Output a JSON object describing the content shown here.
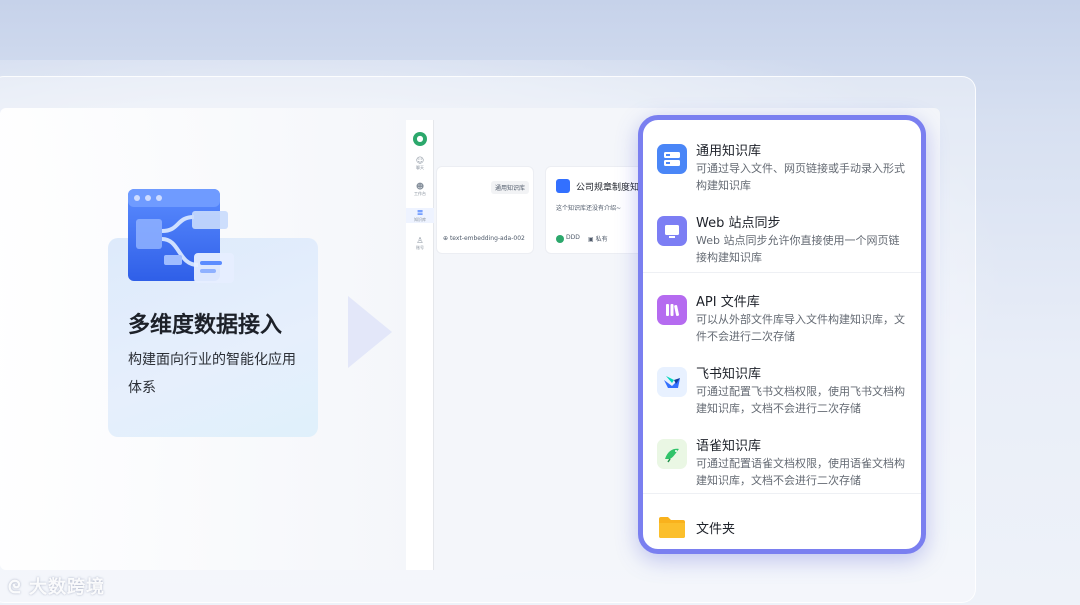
{
  "feature": {
    "title": "多维度数据接入",
    "subtitle": "构建面向行业的智能化应用体系"
  },
  "sidebar": {
    "items": [
      {
        "label": "聊天",
        "icon": "chat-icon"
      },
      {
        "label": "工作台",
        "icon": "robot-icon"
      },
      {
        "label": "知识库",
        "icon": "database-icon"
      },
      {
        "label": "账号",
        "icon": "user-icon"
      }
    ]
  },
  "kb_cards": [
    {
      "tag": "通用知识库",
      "model": "text-embedding-ada-002"
    },
    {
      "title": "公司规章制度知识",
      "desc": "这个知识库还没有介绍~",
      "owner": "DDD",
      "visibility": "私有"
    }
  ],
  "popup": {
    "options": [
      {
        "title": "通用知识库",
        "desc": "可通过导入文件、网页链接或手动录入形式构建知识库",
        "icon": "server-icon"
      },
      {
        "title": "Web 站点同步",
        "desc": "Web 站点同步允许你直接使用一个网页链接构建知识库",
        "icon": "monitor-icon"
      },
      {
        "title": "API 文件库",
        "desc": "可以从外部文件库导入文件构建知识库，文件不会进行二次存储",
        "icon": "books-icon"
      },
      {
        "title": "飞书知识库",
        "desc": "可通过配置飞书文档权限，使用飞书文档构建知识库，文档不会进行二次存储",
        "icon": "feishu-icon"
      },
      {
        "title": "语雀知识库",
        "desc": "可通过配置语雀文档权限，使用语雀文档构建知识库，文档不会进行二次存储",
        "icon": "yuque-icon"
      },
      {
        "title": "文件夹",
        "icon": "folder-icon"
      }
    ]
  },
  "watermark": "大数跨境",
  "colors": {
    "accent": "#3370ff",
    "popup_border": "#7a7ff0"
  }
}
